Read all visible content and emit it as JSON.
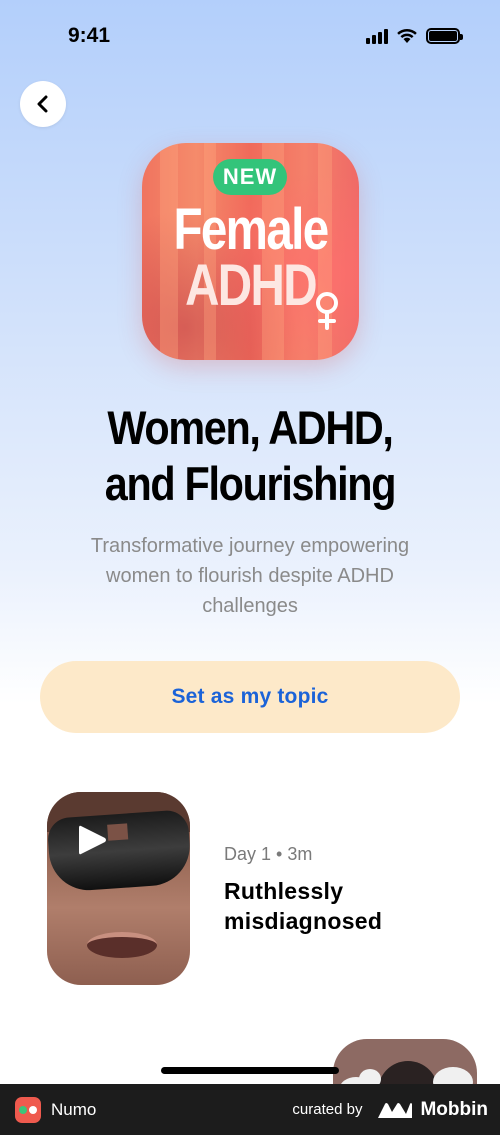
{
  "status_bar": {
    "time": "9:41",
    "icons": [
      "signal-icon",
      "wifi-icon",
      "battery-icon"
    ]
  },
  "nav": {
    "back_icon": "chevron-left-icon"
  },
  "hero": {
    "badge": "NEW",
    "art_line1": "Female",
    "art_line2": "ADHD",
    "art_symbol": "venus-icon",
    "colors": {
      "coral": "#f0745f",
      "badge_green": "#33c47a"
    }
  },
  "topic": {
    "title_line1": "Women, ADHD,",
    "title_line2": "and Flourishing",
    "description": "Transformative journey empowering women to flourish despite ADHD challenges"
  },
  "cta": {
    "label": "Set as my topic",
    "colors": {
      "background": "#fde9c9",
      "text": "#1b63d8"
    }
  },
  "episodes": [
    {
      "meta": "Day 1 • 3m",
      "title": "Ruthlessly misdiagnosed",
      "icon": "play-icon"
    }
  ],
  "footer": {
    "app_name": "Numo",
    "curated_by": "curated by",
    "brand": "Mobbin"
  }
}
